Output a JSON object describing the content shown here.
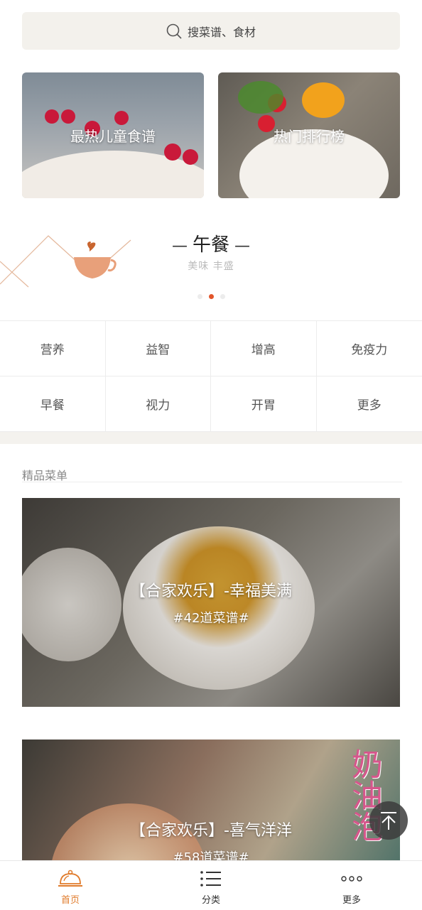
{
  "search": {
    "placeholder": "搜菜谱、食材",
    "icon": "search-icon"
  },
  "top_cards": [
    {
      "label": "最热儿童食谱"
    },
    {
      "label": "热门排行榜"
    }
  ],
  "banner": {
    "title": "午餐",
    "subtitle": "美味 丰盛",
    "dot_count": 3,
    "active_dot": 2,
    "accent": "#e2552b",
    "cup_color": "#e8a07a"
  },
  "categories": [
    {
      "label": "营养"
    },
    {
      "label": "益智"
    },
    {
      "label": "增高"
    },
    {
      "label": "免疫力"
    },
    {
      "label": "早餐"
    },
    {
      "label": "视力"
    },
    {
      "label": "开胃"
    },
    {
      "label": "更多"
    }
  ],
  "section": {
    "title": "精品菜单"
  },
  "menus": [
    {
      "title": "【合家欢乐】-幸福美满",
      "count": "#42道菜谱#"
    },
    {
      "title": "【合家欢乐】-喜气洋洋",
      "count": "#58道菜谱#",
      "side_text": "奶油泡"
    }
  ],
  "back_to_top": {
    "icon": "arrow-up-icon"
  },
  "bottom_nav": [
    {
      "label": "首页",
      "icon": "cloche-icon",
      "active": true
    },
    {
      "label": "分类",
      "icon": "list-icon",
      "active": false
    },
    {
      "label": "更多",
      "icon": "more-dots-icon",
      "active": false
    }
  ],
  "colors": {
    "active_nav": "#e07b2b",
    "search_bg": "#f3f1ec"
  }
}
